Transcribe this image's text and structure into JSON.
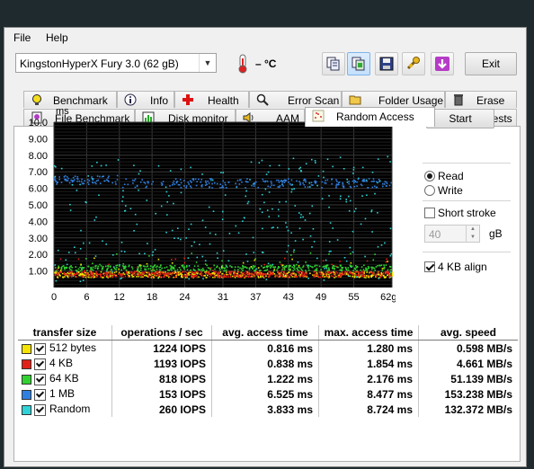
{
  "menu": {
    "file": "File",
    "help": "Help"
  },
  "toolbar": {
    "drive": "KingstonHyperX Fury 3.0  (62 gB)",
    "temperature": "– °C",
    "exit_label": "Exit",
    "buttons": [
      "copy-info-icon",
      "copy-screen-icon",
      "save-icon",
      "tools-icon",
      "download-icon"
    ]
  },
  "tabs_row1": [
    {
      "label": "Benchmark",
      "icon": "bulb-icon"
    },
    {
      "label": "Info",
      "icon": "info-icon"
    },
    {
      "label": "Health",
      "icon": "health-cross-icon"
    },
    {
      "label": "Error Scan",
      "icon": "magnifier-icon"
    },
    {
      "label": "Folder Usage",
      "icon": "folder-icon"
    },
    {
      "label": "Erase",
      "icon": "trash-icon"
    }
  ],
  "tabs_row2": [
    {
      "label": "File Benchmark",
      "icon": "file-bulb-icon"
    },
    {
      "label": "Disk monitor",
      "icon": "bar-chart-icon"
    },
    {
      "label": "AAM",
      "icon": "speaker-icon"
    },
    {
      "label": "Random Access",
      "icon": "scatter-icon",
      "selected": true
    },
    {
      "label": "Extra tests",
      "icon": "table-icon"
    }
  ],
  "chart_data": {
    "type": "scatter",
    "ylabel": "ms",
    "y_ticks": [
      "1.00",
      "2.00",
      "3.00",
      "4.00",
      "5.00",
      "6.00",
      "7.00",
      "8.00",
      "9.00",
      "10.0"
    ],
    "x_ticks": [
      "0",
      "6",
      "12",
      "18",
      "24",
      "31",
      "37",
      "43",
      "49",
      "55",
      "62gB"
    ],
    "ylim": [
      0,
      10
    ],
    "xlim": [
      0,
      62
    ],
    "x_unit": "gB",
    "grid": true,
    "series": [
      {
        "name": "512 bytes",
        "color": "#f5e400",
        "typical_ms": 0.816
      },
      {
        "name": "4 KB",
        "color": "#e32017",
        "typical_ms": 0.838
      },
      {
        "name": "64 KB",
        "color": "#31d230",
        "typical_ms": 1.222
      },
      {
        "name": "1 MB",
        "color": "#2f7fe0",
        "typical_ms": 6.525
      },
      {
        "name": "Random",
        "color": "#2fd2d6",
        "typical_ms": 3.833
      }
    ]
  },
  "controls": {
    "start_label": "Start",
    "read_label": "Read",
    "write_label": "Write",
    "read_selected": true,
    "short_stroke_label": "Short stroke",
    "short_stroke_checked": false,
    "stroke_value": "40",
    "stroke_unit": "gB",
    "align_label": "4 KB align",
    "align_checked": true
  },
  "results": {
    "headers": [
      "transfer size",
      "operations / sec",
      "avg. access time",
      "max. access time",
      "avg. speed"
    ],
    "rows": [
      {
        "size": "512 bytes",
        "color": "#f5e400",
        "ops": "1224 IOPS",
        "avg": "0.816 ms",
        "max": "1.280 ms",
        "speed": "0.598 MB/s"
      },
      {
        "size": "4 KB",
        "color": "#e32017",
        "ops": "1193 IOPS",
        "avg": "0.838 ms",
        "max": "1.854 ms",
        "speed": "4.661 MB/s"
      },
      {
        "size": "64 KB",
        "color": "#31d230",
        "ops": "818 IOPS",
        "avg": "1.222 ms",
        "max": "2.176 ms",
        "speed": "51.139 MB/s"
      },
      {
        "size": "1 MB",
        "color": "#2f7fe0",
        "ops": "153 IOPS",
        "avg": "6.525 ms",
        "max": "8.477 ms",
        "speed": "153.238 MB/s"
      },
      {
        "size": "Random",
        "color": "#2fd2d6",
        "ops": "260 IOPS",
        "avg": "3.833 ms",
        "max": "8.724 ms",
        "speed": "132.372 MB/s"
      }
    ]
  }
}
